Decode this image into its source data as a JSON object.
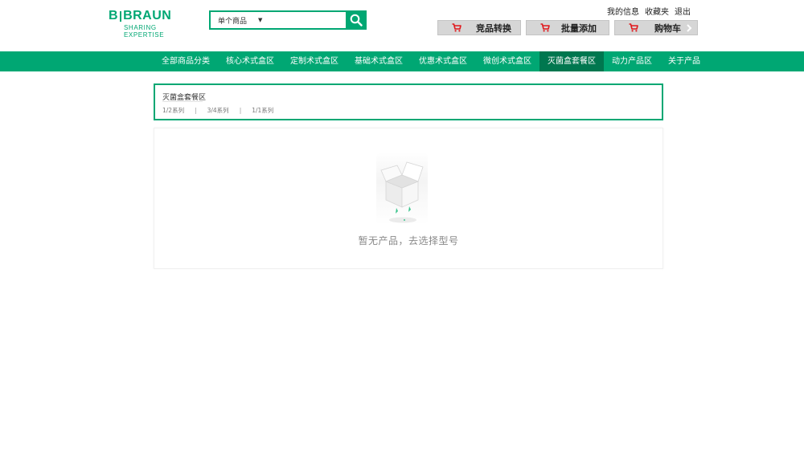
{
  "brand": {
    "logo_left": "B",
    "logo_right": "BRAUN",
    "tagline": "SHARING EXPERTISE",
    "accent_color": "#00a773",
    "active_nav_color": "#00774f"
  },
  "search": {
    "select_value": "单个商品",
    "caret": "▼",
    "button_icon": "search-icon"
  },
  "user_links": {
    "info": "我的信息",
    "favorites": "收藏夹",
    "logout": "退出"
  },
  "actions": {
    "switch_label": "竞品转换",
    "batch_label": "批量添加",
    "cart_label": "购物车",
    "icon": "cart-icon"
  },
  "nav": {
    "items": [
      {
        "label": "全部商品分类"
      },
      {
        "label": "核心术式盒区"
      },
      {
        "label": "定制术式盒区"
      },
      {
        "label": "基础术式盒区"
      },
      {
        "label": "优惠术式盒区"
      },
      {
        "label": "微创术式盒区"
      },
      {
        "label": "灭菌盒套餐区",
        "active": true
      },
      {
        "label": "动力产品区"
      },
      {
        "label": "关于产品"
      }
    ]
  },
  "filter": {
    "title": "灭菌盒套餐区",
    "options": [
      "1/2系列",
      "3/4系列",
      "1/1系列"
    ],
    "separator": "|"
  },
  "empty_state": {
    "message": "暂无产品，去选择型号",
    "icon": "empty-box-icon"
  }
}
